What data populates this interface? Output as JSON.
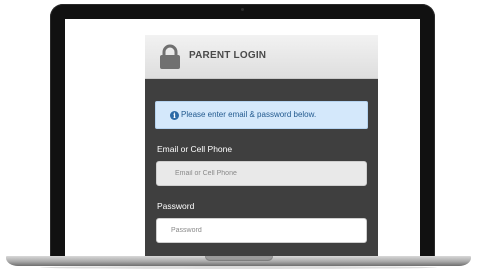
{
  "login": {
    "header_title": "PARENT LOGIN",
    "lock_icon": "lock-icon",
    "info_icon": "info-circle-icon",
    "info_message": "Please enter email & password below.",
    "email_label": "Email or Cell Phone",
    "email_placeholder": "Email or Cell Phone",
    "email_value": "",
    "password_label": "Password",
    "password_placeholder": "Password",
    "password_value": ""
  },
  "colors": {
    "panel_background": "#3f3f3f",
    "header_background": "#e8e8e8",
    "info_background": "#d4e8fb",
    "info_text": "#235a8f",
    "laptop_bezel": "#111111"
  }
}
